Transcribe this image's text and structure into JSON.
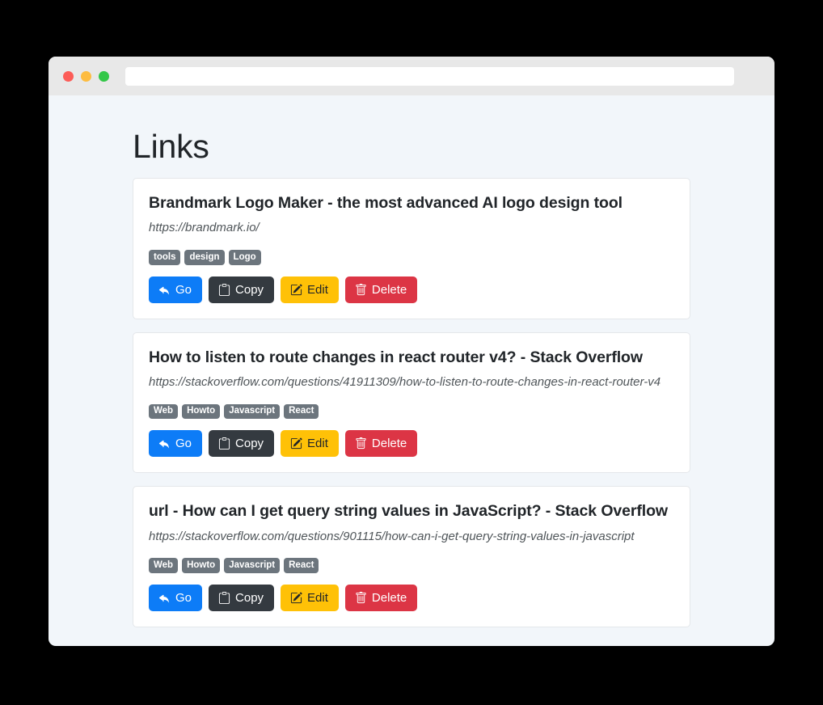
{
  "window": {
    "traffic_lights": [
      {
        "name": "close",
        "color": "#fc5c57"
      },
      {
        "name": "minimize",
        "color": "#fdbc40"
      },
      {
        "name": "maximize",
        "color": "#33c748"
      }
    ],
    "address_bar": {
      "value": "",
      "placeholder": ""
    }
  },
  "page": {
    "title": "Links"
  },
  "buttons": {
    "go": {
      "label": "Go",
      "icon": "reply-arrow-icon",
      "color": "#0d7cf7"
    },
    "copy": {
      "label": "Copy",
      "icon": "copy-icon",
      "color": "#343a40"
    },
    "edit": {
      "label": "Edit",
      "icon": "pencil-square-icon",
      "color": "#ffc107"
    },
    "delete": {
      "label": "Delete",
      "icon": "trash-icon",
      "color": "#dc3545"
    }
  },
  "theme": {
    "page_background": "#f2f6fa",
    "card_background": "#ffffff",
    "card_border": "#e4e7ea",
    "tag_background": "#6c757d",
    "chrome_background": "#e8e8e8"
  },
  "links": [
    {
      "title": "Brandmark Logo Maker - the most advanced AI logo design tool",
      "url": "https://brandmark.io/",
      "tags": [
        "tools",
        "design",
        "Logo"
      ]
    },
    {
      "title": "How to listen to route changes in react router v4? - Stack Overflow",
      "url": "https://stackoverflow.com/questions/41911309/how-to-listen-to-route-changes-in-react-router-v4",
      "tags": [
        "Web",
        "Howto",
        "Javascript",
        "React"
      ]
    },
    {
      "title": "url - How can I get query string values in JavaScript? - Stack Overflow",
      "url": "https://stackoverflow.com/questions/901115/how-can-i-get-query-string-values-in-javascript",
      "tags": [
        "Web",
        "Howto",
        "Javascript",
        "React"
      ]
    }
  ]
}
